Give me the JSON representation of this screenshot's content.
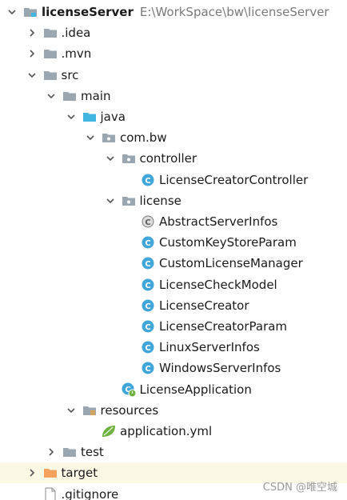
{
  "project": {
    "name": "licenseServer",
    "path": "E:\\WorkSpace\\bw\\licenseServer"
  },
  "tree": [
    {
      "name": "project-root",
      "label": "licenseServer",
      "sub": "E:\\WorkSpace\\bw\\licenseServer",
      "icon": "module-folder-icon",
      "depth": 0,
      "chev": "down"
    },
    {
      "name": "folder-idea",
      "label": ".idea",
      "icon": "folder-icon",
      "depth": 1,
      "chev": "right"
    },
    {
      "name": "folder-mvn",
      "label": ".mvn",
      "icon": "folder-icon",
      "depth": 1,
      "chev": "right"
    },
    {
      "name": "folder-src",
      "label": "src",
      "icon": "folder-icon",
      "depth": 1,
      "chev": "down"
    },
    {
      "name": "folder-main",
      "label": "main",
      "icon": "folder-icon",
      "depth": 2,
      "chev": "down"
    },
    {
      "name": "folder-java",
      "label": "java",
      "icon": "source-folder-icon",
      "depth": 3,
      "chev": "down"
    },
    {
      "name": "package-com-bw",
      "label": "com.bw",
      "icon": "package-icon",
      "depth": 4,
      "chev": "down"
    },
    {
      "name": "package-controller",
      "label": "controller",
      "icon": "package-icon",
      "depth": 5,
      "chev": "down"
    },
    {
      "name": "class-license-creator-controller",
      "label": "LicenseCreatorController",
      "icon": "class-icon",
      "depth": 6,
      "chev": "none"
    },
    {
      "name": "package-license",
      "label": "license",
      "icon": "package-icon",
      "depth": 5,
      "chev": "down"
    },
    {
      "name": "class-abstract-server-infos",
      "label": "AbstractServerInfos",
      "icon": "abstract-class-icon",
      "depth": 6,
      "chev": "none"
    },
    {
      "name": "class-custom-key-store-param",
      "label": "CustomKeyStoreParam",
      "icon": "class-icon",
      "depth": 6,
      "chev": "none"
    },
    {
      "name": "class-custom-license-manager",
      "label": "CustomLicenseManager",
      "icon": "class-icon",
      "depth": 6,
      "chev": "none"
    },
    {
      "name": "class-license-check-model",
      "label": "LicenseCheckModel",
      "icon": "class-icon",
      "depth": 6,
      "chev": "none"
    },
    {
      "name": "class-license-creator",
      "label": "LicenseCreator",
      "icon": "class-icon",
      "depth": 6,
      "chev": "none"
    },
    {
      "name": "class-license-creator-param",
      "label": "LicenseCreatorParam",
      "icon": "class-icon",
      "depth": 6,
      "chev": "none"
    },
    {
      "name": "class-linux-server-infos",
      "label": "LinuxServerInfos",
      "icon": "class-icon",
      "depth": 6,
      "chev": "none"
    },
    {
      "name": "class-windows-server-infos",
      "label": "WindowsServerInfos",
      "icon": "class-icon",
      "depth": 6,
      "chev": "none"
    },
    {
      "name": "class-license-application",
      "label": "LicenseApplication",
      "icon": "spring-boot-class-icon",
      "depth": 5,
      "chev": "none"
    },
    {
      "name": "folder-resources",
      "label": "resources",
      "icon": "resources-folder-icon",
      "depth": 3,
      "chev": "down"
    },
    {
      "name": "file-application-yml",
      "label": "application.yml",
      "icon": "spring-leaf-icon",
      "depth": 4,
      "chev": "none"
    },
    {
      "name": "folder-test",
      "label": "test",
      "icon": "folder-icon",
      "depth": 2,
      "chev": "right"
    },
    {
      "name": "folder-target",
      "label": "target",
      "icon": "excluded-folder-icon",
      "depth": 1,
      "chev": "right",
      "highlight": true
    },
    {
      "name": "file-gitignore",
      "label": ".gitignore",
      "icon": "file-icon",
      "depth": 1,
      "chev": "none"
    }
  ],
  "watermark": "CSDN @唯空城",
  "colors": {
    "folder": "#9aa7b0",
    "source_folder": "#40b6e0",
    "class_blue": "#40a5d8",
    "excluded_folder": "#f5a25d",
    "spring_green": "#6db33f",
    "row_highlight": "#fbf8e6"
  }
}
